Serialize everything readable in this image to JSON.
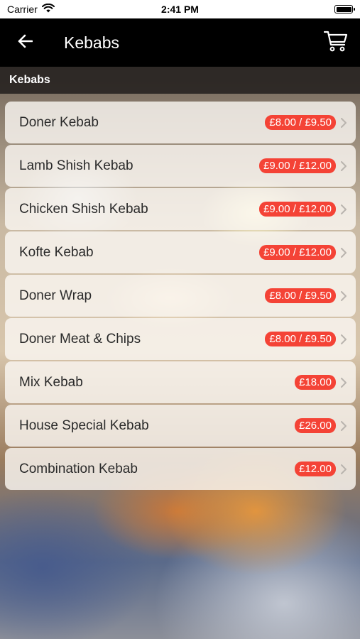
{
  "status_bar": {
    "carrier": "Carrier",
    "time": "2:41 PM",
    "icons": [
      "wifi-icon",
      "battery-icon"
    ]
  },
  "nav": {
    "title": "Kebabs",
    "back_icon": "arrow-left-icon",
    "cart_icon": "shopping-cart-icon"
  },
  "section": {
    "title": "Kebabs"
  },
  "colors": {
    "nav_bg": "#000000",
    "price_badge": "#f44336",
    "row_bg": "#faf6f2"
  },
  "items": [
    {
      "name": "Doner Kebab",
      "price": "£8.00 / £9.50"
    },
    {
      "name": "Lamb Shish Kebab",
      "price": "£9.00 / £12.00"
    },
    {
      "name": "Chicken Shish Kebab",
      "price": "£9.00 / £12.00"
    },
    {
      "name": "Kofte Kebab",
      "price": "£9.00 / £12.00"
    },
    {
      "name": "Doner Wrap",
      "price": "£8.00 / £9.50"
    },
    {
      "name": "Doner Meat & Chips",
      "price": "£8.00 / £9.50"
    },
    {
      "name": "Mix Kebab",
      "price": "£18.00"
    },
    {
      "name": "House Special Kebab",
      "price": "£26.00"
    },
    {
      "name": "Combination Kebab",
      "price": "£12.00"
    }
  ]
}
